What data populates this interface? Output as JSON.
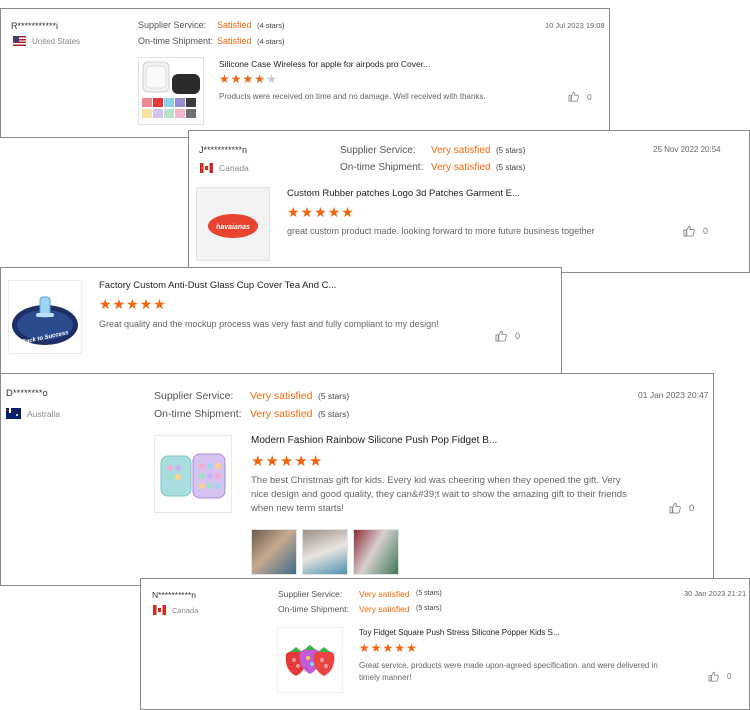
{
  "labels": {
    "supplier_service": "Supplier Service:",
    "on_time_shipment": "On-time Shipment:"
  },
  "reviews": [
    {
      "reviewer": "R***********i",
      "country": "United States",
      "supplier_value": "Satisfied",
      "supplier_stars": "(4 stars)",
      "shipment_value": "Satisfied",
      "shipment_stars": "(4 stars)",
      "date": "10 Jul 2023 19:08",
      "product_title": "Silicone Case Wireless for apple for airpods pro Cover...",
      "rating": 4,
      "comment": "Products were received on time and no damage. Well received with thanks.",
      "likes": "0"
    },
    {
      "reviewer": "J***********n",
      "country": "Canada",
      "supplier_value": "Very satisfied",
      "supplier_stars": "(5 stars)",
      "shipment_value": "Very satisfied",
      "shipment_stars": "(5 stars)",
      "date": "25 Nov 2022 20:54",
      "product_title": "Custom Rubber patches Logo 3d Patches Garment E...",
      "product_image_text": "havaianas",
      "rating": 5,
      "comment": "great custom product made. looking forward to more future business together",
      "likes": "0"
    },
    {
      "product_title": "Factory Custom Anti-Dust Glass Cup Cover Tea And C...",
      "product_image_text": "Back to Success",
      "rating": 5,
      "comment": "Great quality and the mockup process was very fast and fully compliant to my design!",
      "likes": "0"
    },
    {
      "reviewer": "D********o",
      "country": "Australia",
      "supplier_value": "Very satisfied",
      "supplier_stars": "(5 stars)",
      "shipment_value": "Very satisfied",
      "shipment_stars": "(5 stars)",
      "date": "01 Jan 2023 20:47",
      "product_title": "Modern Fashion Rainbow Silicone Push Pop Fidget B...",
      "rating": 5,
      "comment": "The best Christmas gift for kids. Every kid was cheering when they opened the gift. Very nice design and good quality, they can&#39;t wait to show the amazing gift to their friends when new term starts!",
      "likes": "0"
    },
    {
      "reviewer": "N**********n",
      "country": "Canada",
      "supplier_value": "Very satisfied",
      "supplier_stars": "(5 stars)",
      "shipment_value": "Very satisfied",
      "shipment_stars": "(5 stars)",
      "date": "30 Jan 2023 21:21",
      "product_title": "Toy Fidget Square Push Stress Silicone Popper Kids S...",
      "rating": 5,
      "comment": "Great service, products were made upon-agreed specification. and were delivered in timely manner!",
      "likes": "0"
    }
  ],
  "colors": {
    "accent": "#f06a0f",
    "star": "#f3640f",
    "border": "#8a8a8a"
  },
  "icons": {
    "like": "thumbs-up-icon"
  }
}
